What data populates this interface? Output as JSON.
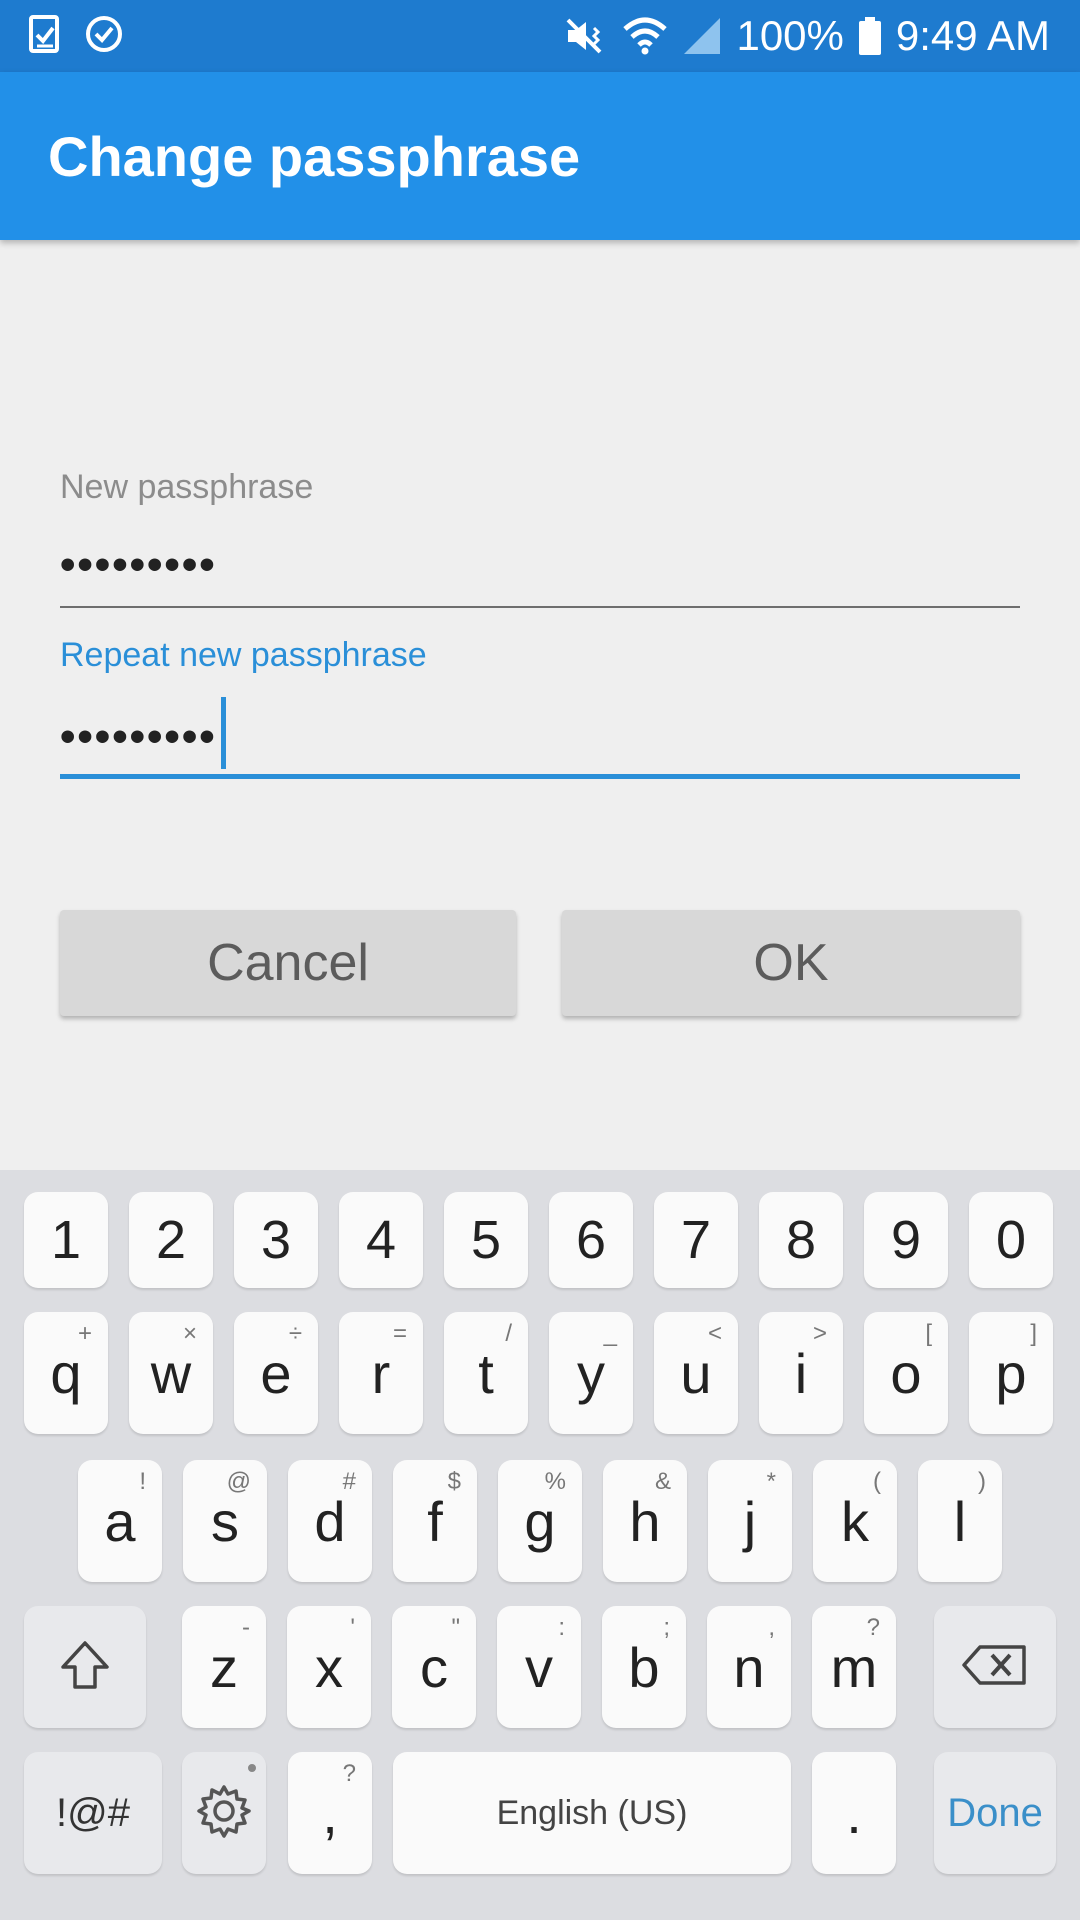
{
  "status_bar": {
    "battery_percent": "100%",
    "time": "9:49 AM",
    "icons": [
      "task-icon",
      "check-circle-icon",
      "mute-vibrate-icon",
      "wifi-icon",
      "signal-icon",
      "battery-icon"
    ]
  },
  "app_bar": {
    "title": "Change passphrase"
  },
  "form": {
    "new_label": "New passphrase",
    "new_value": "•••••••••",
    "repeat_label": "Repeat new passphrase",
    "repeat_value": "•••••••••"
  },
  "buttons": {
    "cancel": "Cancel",
    "ok": "OK"
  },
  "colors": {
    "status_bar": "#1e7bcf",
    "app_bar": "#2290e8",
    "accent": "#2a8fd8"
  },
  "keyboard": {
    "numbers": [
      "1",
      "2",
      "3",
      "4",
      "5",
      "6",
      "7",
      "8",
      "9",
      "0"
    ],
    "row1": [
      {
        "k": "q",
        "s": "+"
      },
      {
        "k": "w",
        "s": "×"
      },
      {
        "k": "e",
        "s": "÷"
      },
      {
        "k": "r",
        "s": "="
      },
      {
        "k": "t",
        "s": "/"
      },
      {
        "k": "y",
        "s": "_"
      },
      {
        "k": "u",
        "s": "<"
      },
      {
        "k": "i",
        "s": ">"
      },
      {
        "k": "o",
        "s": "["
      },
      {
        "k": "p",
        "s": "]"
      }
    ],
    "row2": [
      {
        "k": "a",
        "s": "!"
      },
      {
        "k": "s",
        "s": "@"
      },
      {
        "k": "d",
        "s": "#"
      },
      {
        "k": "f",
        "s": "$"
      },
      {
        "k": "g",
        "s": "%"
      },
      {
        "k": "h",
        "s": "&"
      },
      {
        "k": "j",
        "s": "*"
      },
      {
        "k": "k",
        "s": "("
      },
      {
        "k": "l",
        "s": ")"
      }
    ],
    "row3": [
      {
        "k": "z",
        "s": "-"
      },
      {
        "k": "x",
        "s": "'"
      },
      {
        "k": "c",
        "s": "\""
      },
      {
        "k": "v",
        "s": ":"
      },
      {
        "k": "b",
        "s": ";"
      },
      {
        "k": "n",
        "s": ","
      },
      {
        "k": "m",
        "s": "?"
      }
    ],
    "symbols_label": "!@#",
    "comma": {
      "k": ",",
      "s": "?"
    },
    "space_label": "English (US)",
    "period": ".",
    "done_label": "Done"
  }
}
